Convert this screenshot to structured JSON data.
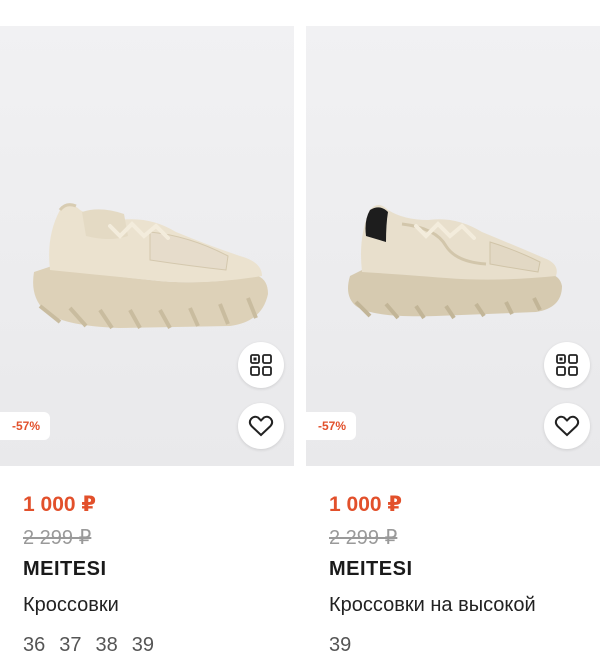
{
  "products": [
    {
      "discount": "-57%",
      "price": "1 000 ₽",
      "old_price": "2 299 ₽",
      "brand": "MEITESI",
      "name": "Кроссовки",
      "sizes": [
        "36",
        "37",
        "38",
        "39"
      ],
      "image_icon": "beige-chunky-sneaker",
      "similar_icon": "similar-items-icon",
      "favorite_icon": "heart-icon"
    },
    {
      "discount": "-57%",
      "price": "1 000 ₽",
      "old_price": "2 299 ₽",
      "brand": "MEITESI",
      "name": "Кроссовки на высокой",
      "sizes": [
        "39"
      ],
      "image_icon": "beige-sneaker-black-trim",
      "similar_icon": "similar-items-icon",
      "favorite_icon": "heart-icon"
    }
  ],
  "colors": {
    "accent": "#e2502b",
    "old_price": "#9a9a9a",
    "image_bg": "#efeff1",
    "shoe": "#e3d8c2"
  }
}
